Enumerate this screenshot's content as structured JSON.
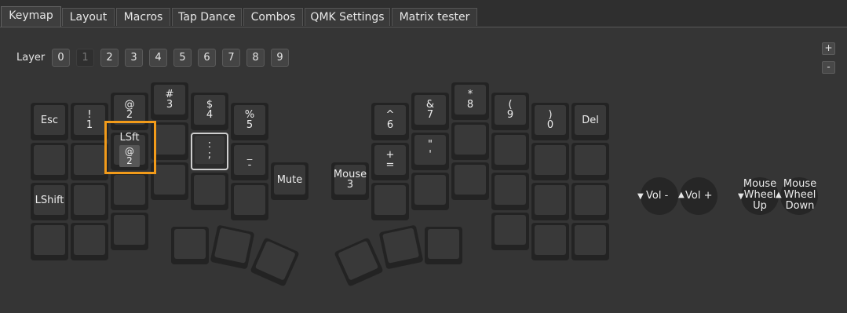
{
  "tabs": [
    "Keymap",
    "Layout",
    "Macros",
    "Tap Dance",
    "Combos",
    "QMK Settings",
    "Matrix tester"
  ],
  "active_tab": 0,
  "layer": {
    "label": "Layer",
    "buttons": [
      "0",
      "1",
      "2",
      "3",
      "4",
      "5",
      "6",
      "7",
      "8",
      "9"
    ],
    "active": 1
  },
  "zoom": {
    "in_label": "+",
    "out_label": "-"
  },
  "keys": {
    "esc": "Esc",
    "excl_1": "!\n1",
    "at_2": "@\n2",
    "hash_3": "#\n3",
    "dollar_4": "$\n4",
    "pct_5": "%\n5",
    "caret_6": "^\n6",
    "amp_7": "&\n7",
    "star_8": "*\n8",
    "lparen_9": "(\n9",
    "rparen_0": ")\n0",
    "del": "Del",
    "lsft_top": "LSft",
    "lsft_inner": "@\n2",
    "colon_semi": ":\n;",
    "under_minus": "_\n-",
    "plus_equal": "+\n=",
    "dquote_quote": "\"\n'",
    "lshift": "LShift",
    "mute": "Mute",
    "mouse3": "Mouse\n3"
  },
  "encoders": {
    "vol_down": "Vol -",
    "vol_up": "Vol +",
    "wheel_up": "Mouse\nWheel\nUp",
    "wheel_down": "Mouse\nWheel\nDown"
  }
}
